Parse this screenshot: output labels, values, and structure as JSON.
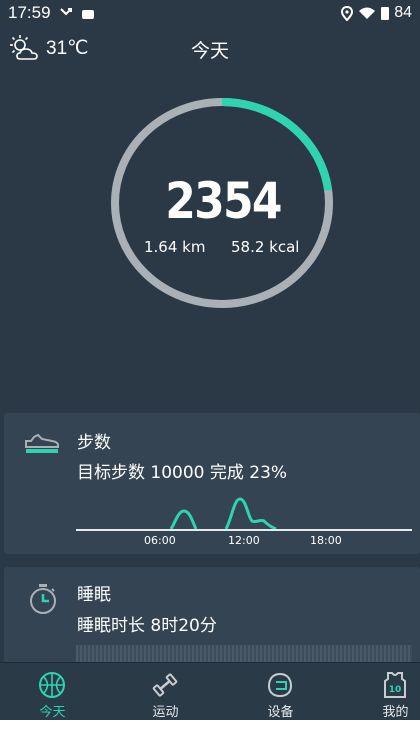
{
  "status_bar": {
    "time": "17:59",
    "battery": "84"
  },
  "header": {
    "temperature": "31℃",
    "title": "今天",
    "weather_icon": "sun-cloud-icon"
  },
  "summary": {
    "steps": "2354",
    "distance": "1.64 km",
    "calories": "58.2 kcal",
    "progress_fraction": 0.23
  },
  "colors": {
    "accent": "#2ed3b0",
    "background": "#2b3946",
    "card": "#344453",
    "ring_track": "#a9b0b6"
  },
  "steps_card": {
    "title": "步数",
    "subtitle": "目标步数 10000 完成 23%",
    "time_labels": [
      "06:00",
      "12:00",
      "18:00"
    ]
  },
  "sleep_card": {
    "title": "睡眠",
    "subtitle": "睡眠时长 8时20分"
  },
  "tabs": [
    {
      "label": "今天",
      "icon": "basketball-icon",
      "active": true
    },
    {
      "label": "运动",
      "icon": "dumbbell-icon",
      "active": false
    },
    {
      "label": "设备",
      "icon": "device-icon",
      "active": false
    },
    {
      "label": "我的",
      "icon": "jersey-icon",
      "jersey_number": "10",
      "active": false
    }
  ]
}
